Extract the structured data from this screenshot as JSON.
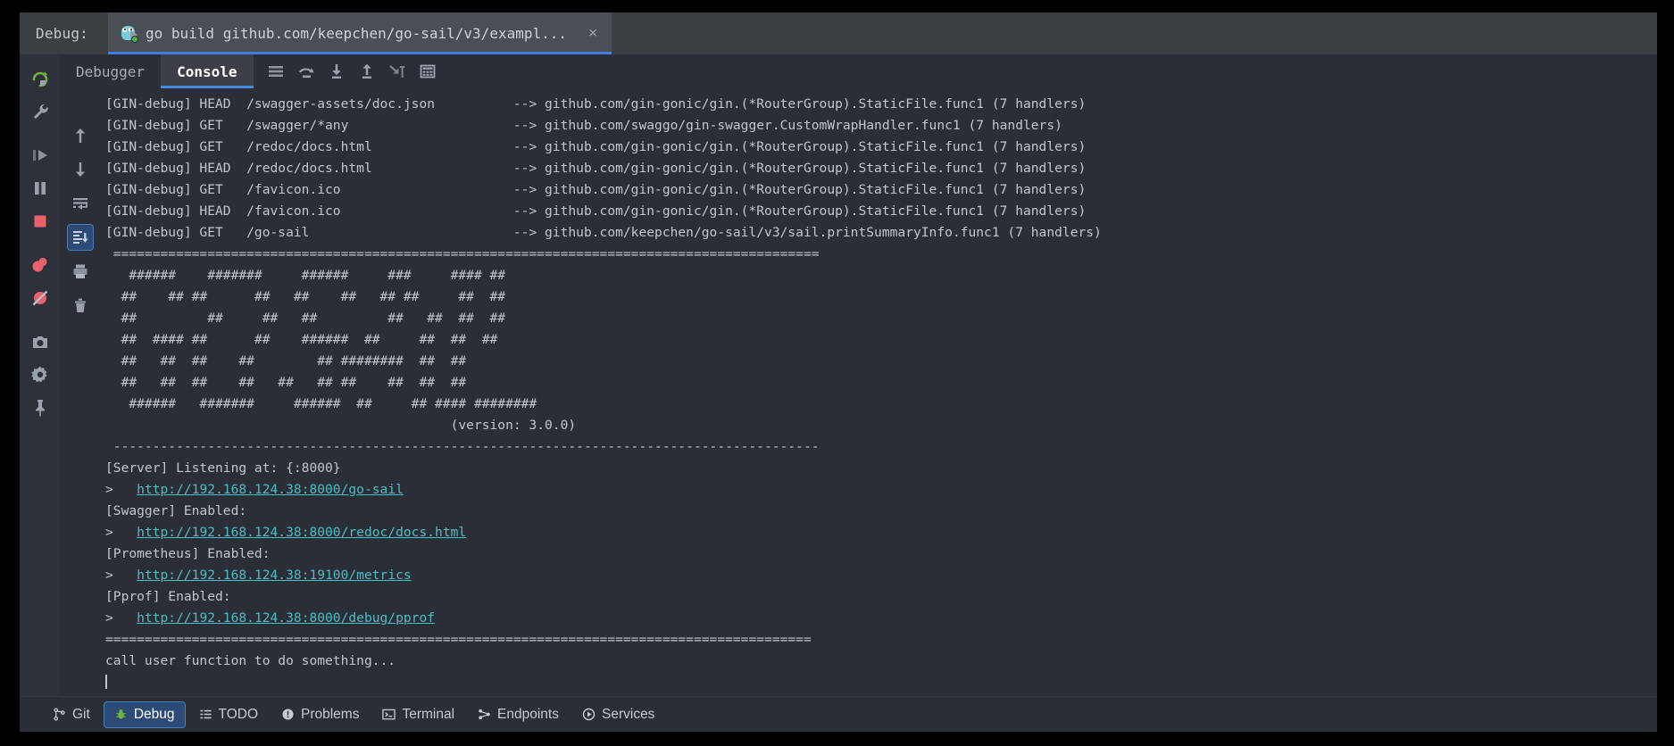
{
  "titlebar": {
    "label": "Debug:",
    "tab_title": "go build github.com/keepchen/go-sail/v3/exampl...",
    "close_label": "×",
    "gopher_icon": "go-gopher-icon",
    "accent": "#3f7de0"
  },
  "left_rail": {
    "items": [
      {
        "name": "rerun-button",
        "icon": "rerun-icon"
      },
      {
        "name": "debug-settings-button",
        "icon": "wrench-icon"
      },
      {
        "name": "resume-program-button",
        "icon": "resume-icon"
      },
      {
        "name": "pause-program-button",
        "icon": "pause-icon"
      },
      {
        "name": "stop-button",
        "icon": "stop-icon"
      },
      {
        "name": "view-breakpoints-button",
        "icon": "breakpoints-icon"
      },
      {
        "name": "mute-breakpoints-button",
        "icon": "mute-breakpoints-icon"
      },
      {
        "name": "screenshot-button",
        "icon": "camera-icon"
      },
      {
        "name": "settings-button",
        "icon": "gear-icon"
      },
      {
        "name": "pin-tab-button",
        "icon": "pin-icon"
      }
    ]
  },
  "console_rail": {
    "items": [
      {
        "name": "scroll-up-button",
        "icon": "arrow-up-icon",
        "selected": false
      },
      {
        "name": "scroll-down-button",
        "icon": "arrow-down-icon",
        "selected": false
      },
      {
        "name": "soft-wrap-button",
        "icon": "soft-wrap-icon",
        "selected": false
      },
      {
        "name": "scroll-to-end-button",
        "icon": "scroll-to-end-icon",
        "selected": true
      },
      {
        "name": "print-button",
        "icon": "print-icon",
        "selected": false
      },
      {
        "name": "clear-all-button",
        "icon": "trash-icon",
        "selected": false
      }
    ]
  },
  "tabs": {
    "items": [
      {
        "label": "Debugger",
        "active": false
      },
      {
        "label": "Console",
        "active": true
      }
    ],
    "toolbar_buttons": [
      {
        "name": "show-console-menu-button",
        "icon": "lines-icon"
      },
      {
        "name": "step-over-button",
        "icon": "step-over-icon"
      },
      {
        "name": "step-into-button",
        "icon": "step-into-icon"
      },
      {
        "name": "step-out-button",
        "icon": "step-out-icon"
      },
      {
        "name": "force-step-into-button",
        "icon": "force-step-into-icon"
      },
      {
        "name": "evaluate-expression-button",
        "icon": "calculator-icon"
      }
    ]
  },
  "console": {
    "gin_debug_lines": [
      {
        "method": "HEAD",
        "path": "/swagger-assets/doc.json",
        "handler": "--> github.com/gin-gonic/gin.(*RouterGroup).StaticFile.func1 (7 handlers)"
      },
      {
        "method": "GET",
        "path": "/swagger/*any",
        "handler": "--> github.com/swaggo/gin-swagger.CustomWrapHandler.func1 (7 handlers)"
      },
      {
        "method": "GET",
        "path": "/redoc/docs.html",
        "handler": "--> github.com/gin-gonic/gin.(*RouterGroup).StaticFile.func1 (7 handlers)"
      },
      {
        "method": "HEAD",
        "path": "/redoc/docs.html",
        "handler": "--> github.com/gin-gonic/gin.(*RouterGroup).StaticFile.func1 (7 handlers)"
      },
      {
        "method": "GET",
        "path": "/favicon.ico",
        "handler": "--> github.com/gin-gonic/gin.(*RouterGroup).StaticFile.func1 (7 handlers)"
      },
      {
        "method": "HEAD",
        "path": "/favicon.ico",
        "handler": "--> github.com/gin-gonic/gin.(*RouterGroup).StaticFile.func1 (7 handlers)"
      },
      {
        "method": "GET",
        "path": "/go-sail",
        "handler": "--> github.com/keepchen/go-sail/v3/sail.printSummaryInfo.func1 (7 handlers)"
      }
    ],
    "prefix": "[GIN-debug] ",
    "divider_equals": "==========================================================================================",
    "divider_dashes": "------------------------------------------------------------------------------------------",
    "banner_lines": [
      "  ######    #######     ######     ###     #### ##",
      " ##    ## ##      ##   ##    ##   ## ##     ##  ##",
      " ##         ##     ##   ##         ##   ##  ##  ##",
      " ##  #### ##      ##    ######  ##     ##  ##  ##",
      " ##   ##  ##    ##        ## ########  ##  ##",
      " ##   ##  ##    ##   ##   ## ##    ##  ##  ##",
      "  ######   #######     ######  ##     ## #### ########"
    ],
    "version_text": "(version: 3.0.0)",
    "server_section": [
      {
        "type": "text",
        "text": "[Server] Listening at: {:8000}"
      },
      {
        "type": "link",
        "prefix": ">   ",
        "url": "http://192.168.124.38:8000/go-sail"
      },
      {
        "type": "text",
        "text": "[Swagger] Enabled:"
      },
      {
        "type": "link",
        "prefix": ">   ",
        "url": "http://192.168.124.38:8000/redoc/docs.html"
      },
      {
        "type": "text",
        "text": "[Prometheus] Enabled:"
      },
      {
        "type": "link",
        "prefix": ">   ",
        "url": "http://192.168.124.38:19100/metrics"
      },
      {
        "type": "text",
        "text": "[Pprof] Enabled:"
      },
      {
        "type": "link",
        "prefix": ">   ",
        "url": "http://192.168.124.38:8000/debug/pprof"
      }
    ],
    "final_message": "call user function to do something...",
    "link_color": "#49c0c7"
  },
  "statusbar": {
    "items": [
      {
        "label": "Git",
        "icon": "git-branch-icon",
        "active": false
      },
      {
        "label": "Debug",
        "icon": "debug-bug-icon",
        "active": true
      },
      {
        "label": "TODO",
        "icon": "todo-list-icon",
        "active": false
      },
      {
        "label": "Problems",
        "icon": "problems-icon",
        "active": false
      },
      {
        "label": "Terminal",
        "icon": "terminal-icon",
        "active": false
      },
      {
        "label": "Endpoints",
        "icon": "endpoints-icon",
        "active": false
      },
      {
        "label": "Services",
        "icon": "services-icon",
        "active": false
      }
    ]
  }
}
